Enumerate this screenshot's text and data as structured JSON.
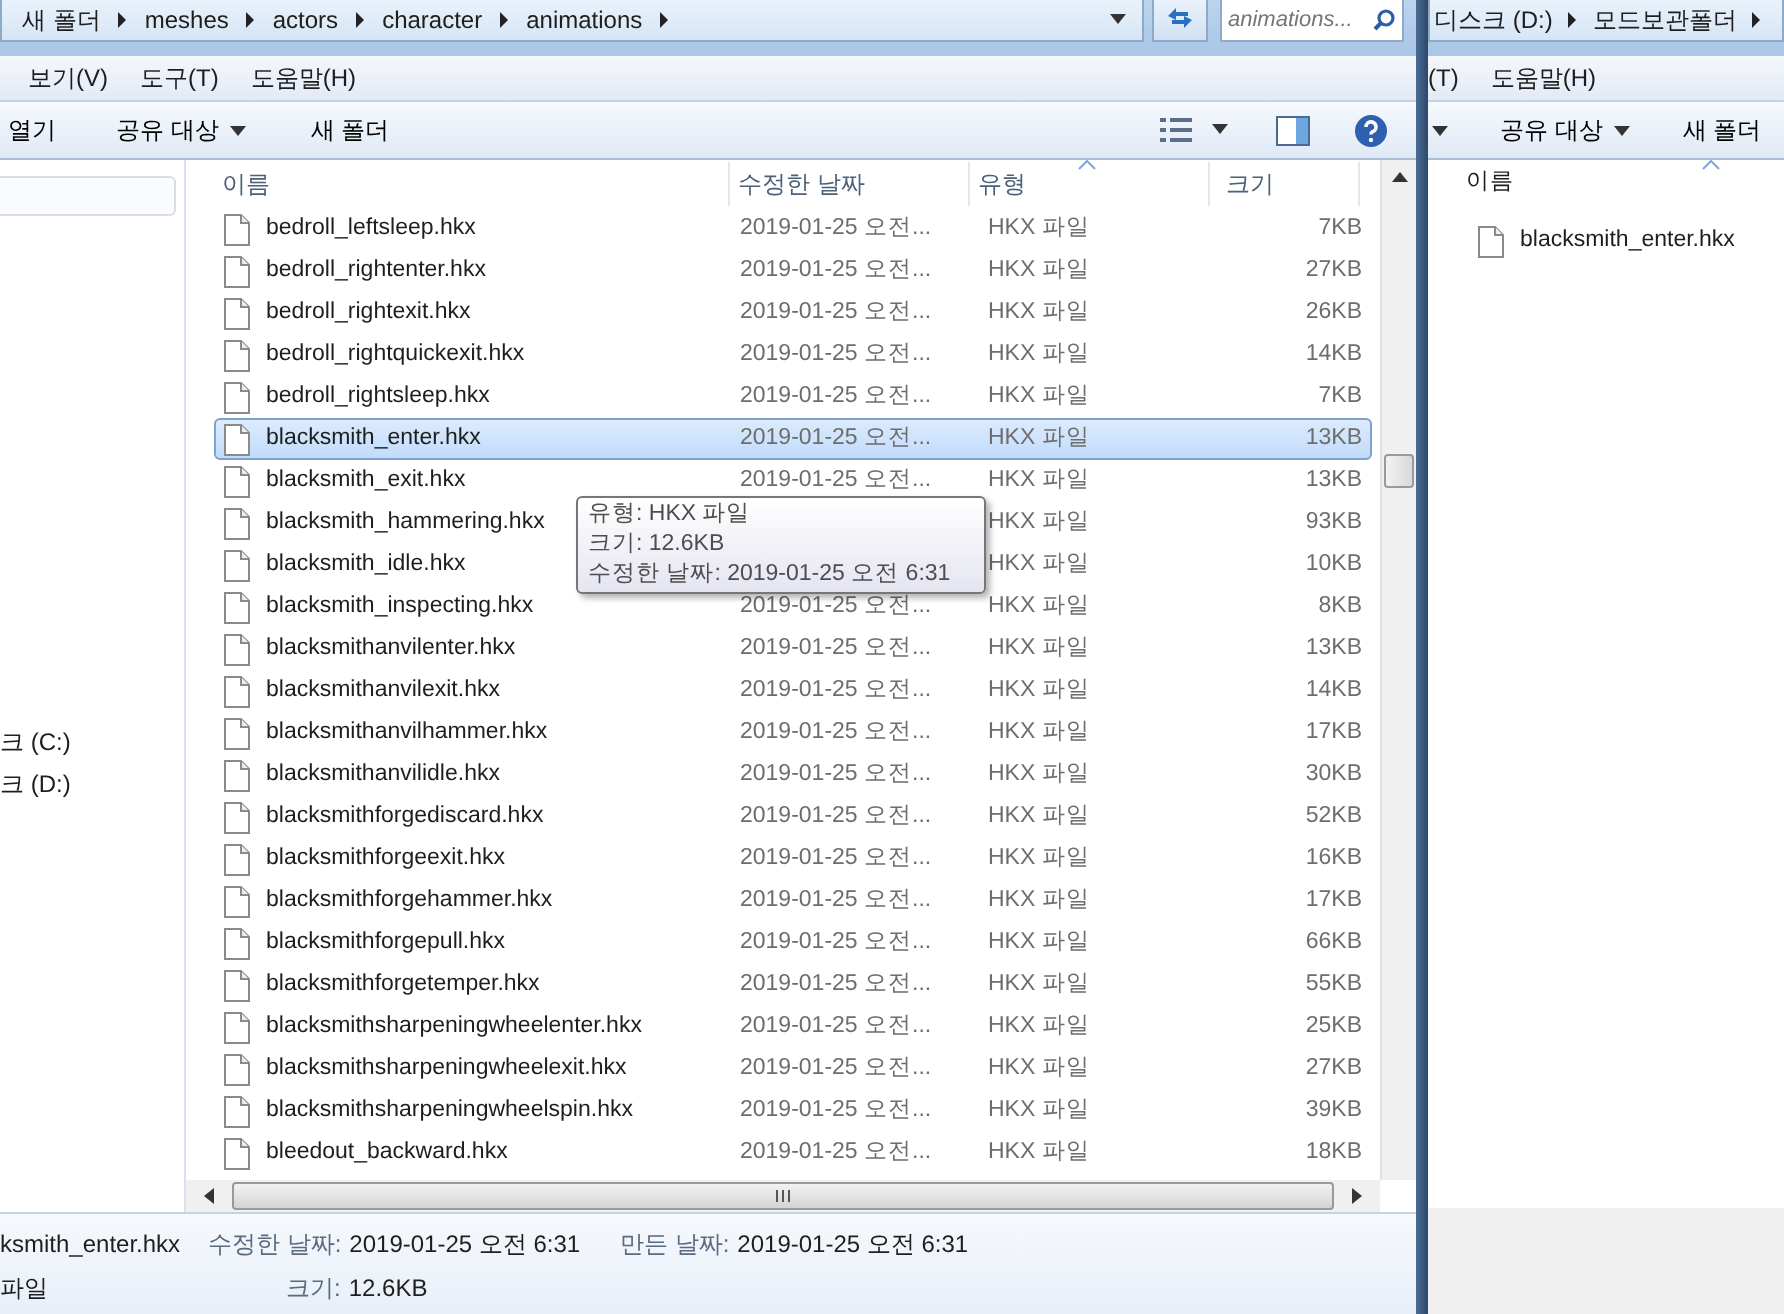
{
  "main_window": {
    "breadcrumb": [
      "새 폴더",
      "meshes",
      "actors",
      "character",
      "animations"
    ],
    "search": {
      "placeholder": "animations..."
    },
    "menu": [
      "보기(V)",
      "도구(T)",
      "도움말(H)"
    ],
    "toolbar": [
      {
        "label": "열기",
        "dropdown": false
      },
      {
        "label": "공유 대상",
        "dropdown": true
      },
      {
        "label": "새 폴더",
        "dropdown": false
      }
    ],
    "nav_items": [
      "크 (C:)",
      "크 (D:)"
    ],
    "columns": [
      "이름",
      "수정한 날짜",
      "유형",
      "크기"
    ],
    "rows": [
      {
        "name": "bedroll_leftsleep.hkx",
        "date": "2019-01-25 오전...",
        "type": "HKX 파일",
        "size": "7KB",
        "selected": false
      },
      {
        "name": "bedroll_rightenter.hkx",
        "date": "2019-01-25 오전...",
        "type": "HKX 파일",
        "size": "27KB",
        "selected": false
      },
      {
        "name": "bedroll_rightexit.hkx",
        "date": "2019-01-25 오전...",
        "type": "HKX 파일",
        "size": "26KB",
        "selected": false
      },
      {
        "name": "bedroll_rightquickexit.hkx",
        "date": "2019-01-25 오전...",
        "type": "HKX 파일",
        "size": "14KB",
        "selected": false
      },
      {
        "name": "bedroll_rightsleep.hkx",
        "date": "2019-01-25 오전...",
        "type": "HKX 파일",
        "size": "7KB",
        "selected": false
      },
      {
        "name": "blacksmith_enter.hkx",
        "date": "2019-01-25 오전...",
        "type": "HKX 파일",
        "size": "13KB",
        "selected": true
      },
      {
        "name": "blacksmith_exit.hkx",
        "date": "2019-01-25 오전...",
        "type": "HKX 파일",
        "size": "13KB",
        "selected": false
      },
      {
        "name": "blacksmith_hammering.hkx",
        "type": "HKX 파일",
        "size": "93KB",
        "selected": false
      },
      {
        "name": "blacksmith_idle.hkx",
        "type": "HKX 파일",
        "size": "10KB",
        "selected": false
      },
      {
        "name": "blacksmith_inspecting.hkx",
        "date": "2019-01-25 오전...",
        "type": "HKX 파일",
        "size": "8KB",
        "selected": false
      },
      {
        "name": "blacksmithanvilenter.hkx",
        "date": "2019-01-25 오전...",
        "type": "HKX 파일",
        "size": "13KB",
        "selected": false
      },
      {
        "name": "blacksmithanvilexit.hkx",
        "date": "2019-01-25 오전...",
        "type": "HKX 파일",
        "size": "14KB",
        "selected": false
      },
      {
        "name": "blacksmithanvilhammer.hkx",
        "date": "2019-01-25 오전...",
        "type": "HKX 파일",
        "size": "17KB",
        "selected": false
      },
      {
        "name": "blacksmithanvilidle.hkx",
        "date": "2019-01-25 오전...",
        "type": "HKX 파일",
        "size": "30KB",
        "selected": false
      },
      {
        "name": "blacksmithforgediscard.hkx",
        "date": "2019-01-25 오전...",
        "type": "HKX 파일",
        "size": "52KB",
        "selected": false
      },
      {
        "name": "blacksmithforgeexit.hkx",
        "date": "2019-01-25 오전...",
        "type": "HKX 파일",
        "size": "16KB",
        "selected": false
      },
      {
        "name": "blacksmithforgehammer.hkx",
        "date": "2019-01-25 오전...",
        "type": "HKX 파일",
        "size": "17KB",
        "selected": false
      },
      {
        "name": "blacksmithforgepull.hkx",
        "date": "2019-01-25 오전...",
        "type": "HKX 파일",
        "size": "66KB",
        "selected": false
      },
      {
        "name": "blacksmithforgetemper.hkx",
        "date": "2019-01-25 오전...",
        "type": "HKX 파일",
        "size": "55KB",
        "selected": false
      },
      {
        "name": "blacksmithsharpeningwheelenter.hkx",
        "date": "2019-01-25 오전...",
        "type": "HKX 파일",
        "size": "25KB",
        "selected": false
      },
      {
        "name": "blacksmithsharpeningwheelexit.hkx",
        "date": "2019-01-25 오전...",
        "type": "HKX 파일",
        "size": "27KB",
        "selected": false
      },
      {
        "name": "blacksmithsharpeningwheelspin.hkx",
        "date": "2019-01-25 오전...",
        "type": "HKX 파일",
        "size": "39KB",
        "selected": false
      },
      {
        "name": "bleedout_backward.hkx",
        "date": "2019-01-25 오전...",
        "type": "HKX 파일",
        "size": "18KB",
        "selected": false
      }
    ],
    "tooltip": [
      "유형: HKX 파일",
      "크기: 12.6KB",
      "수정한 날짜: 2019-01-25 오전 6:31"
    ],
    "details": {
      "name": "ksmith_enter.hkx",
      "type": "파일",
      "modified_label": "수정한 날짜:",
      "modified": "2019-01-25 오전 6:31",
      "created_label": "만든 날짜:",
      "created": "2019-01-25 오전 6:31",
      "size_label": "크기:",
      "size": "12.6KB"
    }
  },
  "second_window": {
    "breadcrumb": [
      "디스크 (D:)",
      "모드보관폴더"
    ],
    "menu": [
      "(T)",
      "도움말(H)"
    ],
    "toolbar": [
      {
        "label": "공유 대상",
        "dropdown": true
      },
      {
        "label": "새 폴더",
        "dropdown": false
      }
    ],
    "columns": [
      "이름"
    ],
    "files": [
      "blacksmith_enter.hkx"
    ]
  }
}
